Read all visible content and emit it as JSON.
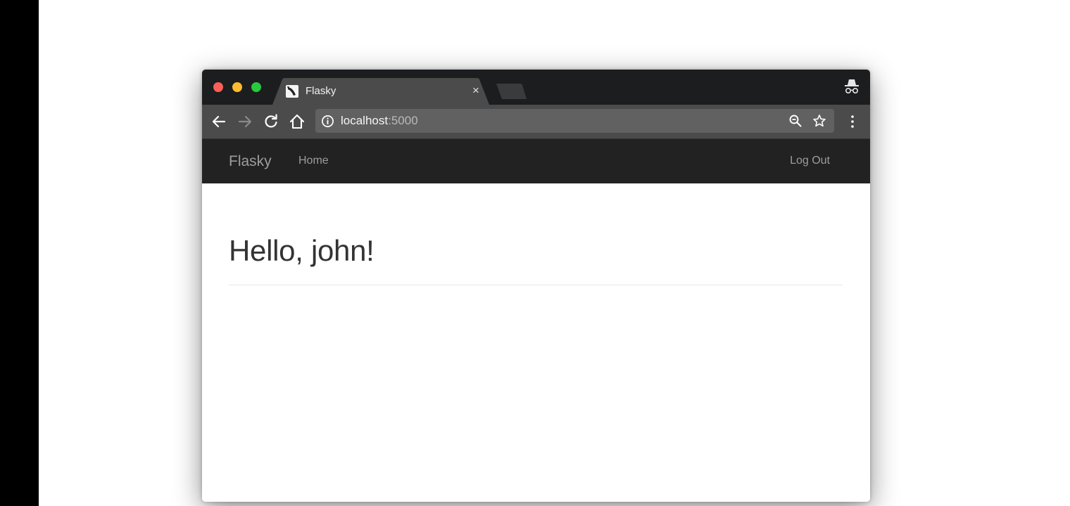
{
  "browser": {
    "tab": {
      "title": "Flasky",
      "close_label": "×"
    },
    "address_bar": {
      "host": "localhost",
      "port": ":5000"
    },
    "icons": [
      "back-icon",
      "forward-icon",
      "reload-icon",
      "home-icon",
      "info-icon",
      "zoom-icon",
      "star-icon",
      "menu-icon",
      "incognito-icon"
    ]
  },
  "navbar": {
    "brand": "Flasky",
    "links": [
      {
        "label": "Home"
      }
    ],
    "right_links": [
      {
        "label": "Log Out"
      }
    ],
    "background": "#222222",
    "link_color": "#9d9d9d"
  },
  "page": {
    "title": "Hello, john!"
  }
}
